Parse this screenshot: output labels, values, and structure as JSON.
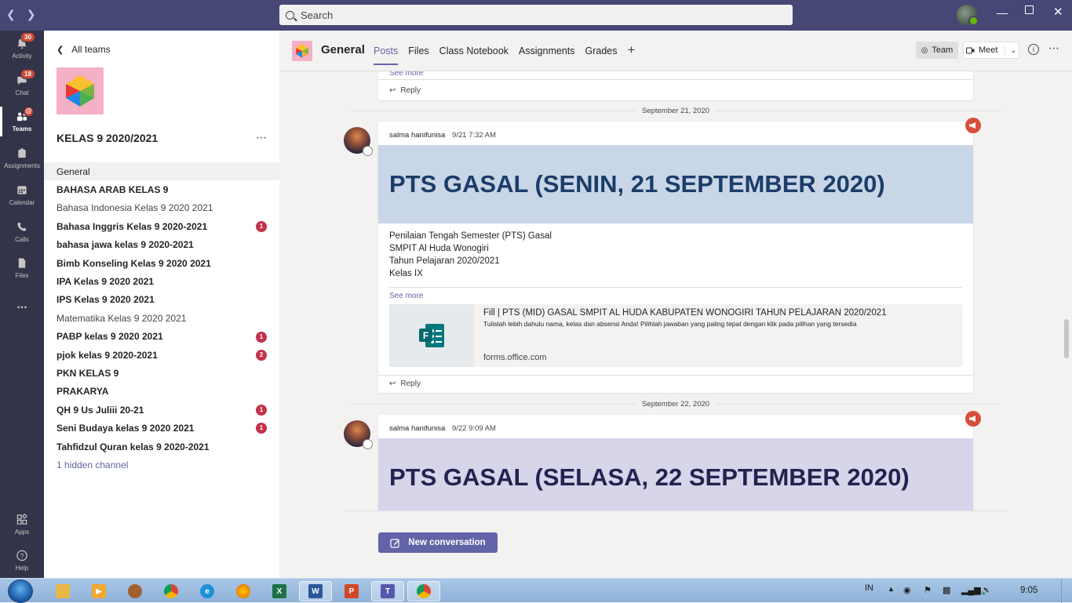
{
  "search": {
    "placeholder": "Search"
  },
  "rail": {
    "items": [
      {
        "label": "Activity",
        "badge": "30"
      },
      {
        "label": "Chat",
        "badge": "18"
      },
      {
        "label": "Teams",
        "badge": "@"
      },
      {
        "label": "Assignments"
      },
      {
        "label": "Calendar"
      },
      {
        "label": "Calls"
      },
      {
        "label": "Files"
      },
      {
        "label": "..."
      },
      {
        "label": "Apps"
      },
      {
        "label": "Help"
      }
    ]
  },
  "team_panel": {
    "back_label": "All teams",
    "team_name": "KELAS 9 2020/2021",
    "channels": [
      {
        "label": "General",
        "style": "active"
      },
      {
        "label": "BAHASA ARAB KELAS 9",
        "style": "bold"
      },
      {
        "label": "Bahasa Indonesia Kelas 9 2020 2021",
        "style": "muted"
      },
      {
        "label": "Bahasa Inggris Kelas 9 2020-2021",
        "style": "bold",
        "badge": "1"
      },
      {
        "label": "bahasa jawa kelas 9 2020-2021",
        "style": "bold"
      },
      {
        "label": "Bimb Konseling Kelas 9 2020 2021",
        "style": "bold"
      },
      {
        "label": "IPA Kelas 9 2020 2021",
        "style": "bold"
      },
      {
        "label": "IPS Kelas 9 2020 2021",
        "style": "bold"
      },
      {
        "label": "Matematika Kelas 9 2020 2021",
        "style": "muted"
      },
      {
        "label": "PABP kelas 9 2020 2021",
        "style": "bold",
        "badge": "1"
      },
      {
        "label": "pjok kelas 9 2020-2021",
        "style": "bold",
        "badge": "2"
      },
      {
        "label": "PKN KELAS 9",
        "style": "bold"
      },
      {
        "label": "PRAKARYA",
        "style": "bold"
      },
      {
        "label": "QH 9 Us Juliii 20-21",
        "style": "bold",
        "badge": "1"
      },
      {
        "label": "Seni Budaya kelas 9 2020 2021",
        "style": "bold",
        "badge": "1"
      },
      {
        "label": "Tahfidzul Quran kelas 9 2020-2021",
        "style": "bold"
      },
      {
        "label": "1 hidden channel",
        "style": "link"
      }
    ]
  },
  "header": {
    "channel_title": "General",
    "tabs": [
      "Posts",
      "Files",
      "Class Notebook",
      "Assignments",
      "Grades"
    ],
    "team_btn": "Team",
    "meet_btn": "Meet"
  },
  "feed": {
    "top_card": {
      "see_more": "See more",
      "reply": "Reply"
    },
    "date1": "September 21, 2020",
    "post1": {
      "author": "salma hanifunisa",
      "time": "9/21 7:32 AM",
      "banner": "PTS GASAL (SENIN, 21 SEPTEMBER 2020)",
      "banner_color": "#c9d6e7",
      "lines": [
        "Penilaian Tengah Semester (PTS)  Gasal",
        "SMPIT Al Huda Wonogiri",
        "Tahun Pelajaran 2020/2021",
        "Kelas IX"
      ],
      "see_more": "See more",
      "preview_title": "Fill | PTS (MID) GASAL SMPIT AL HUDA KABUPATEN WONOGIRI TAHUN PELAJARAN 2020/2021",
      "preview_desc": "Tulislah lebih dahulu nama, kelas dan absensi Anda! Pilihlah jawaban yang paling tepat dengan klik pada pilihan yang tersedia",
      "preview_domain": "forms.office.com",
      "reply": "Reply"
    },
    "date2": "September 22, 2020",
    "post2": {
      "author": "salma hanifunisa",
      "time": "9/22 9:09 AM",
      "banner": "PTS GASAL (SELASA, 22 SEPTEMBER 2020)",
      "banner_color": "#d6d5ea"
    }
  },
  "new_conversation": "New conversation",
  "taskbar": {
    "lang": "IN",
    "clock": "9:05"
  }
}
